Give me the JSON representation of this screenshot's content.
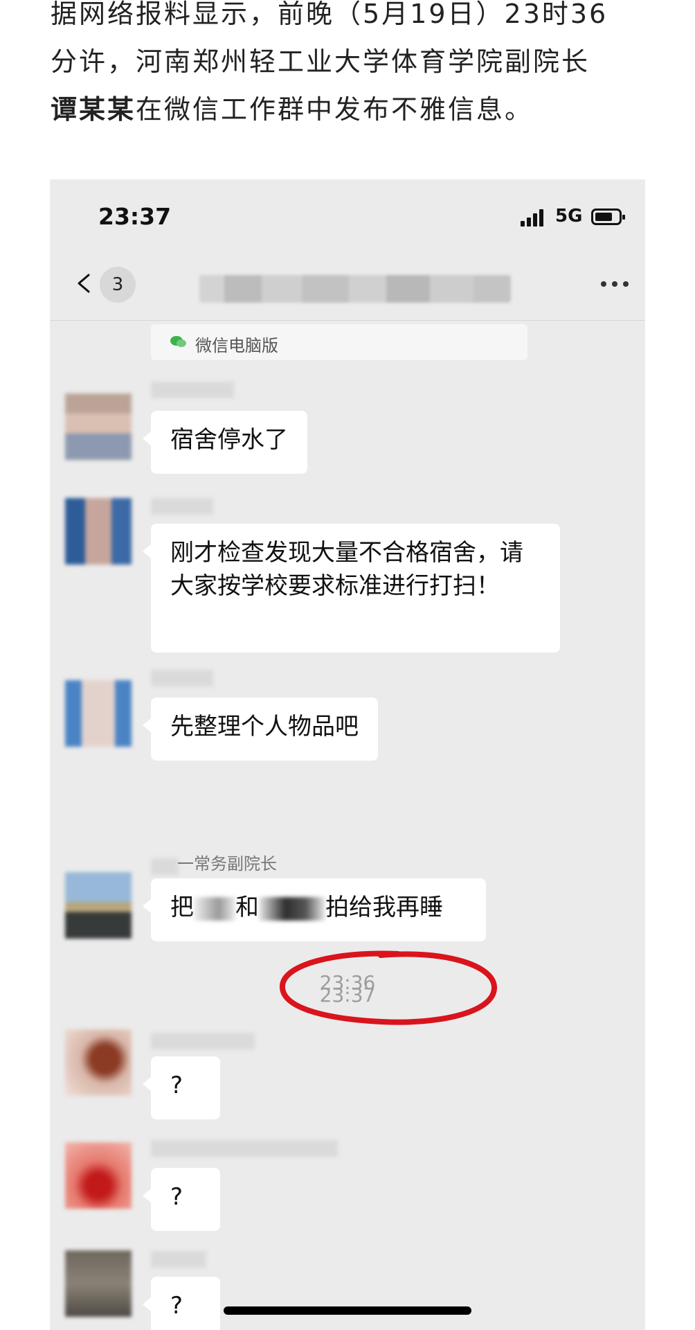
{
  "article": {
    "line1": "据网络报料显示，前晚（5月19日）23时36",
    "line2": "分许，河南郑州轻工业大学体育学院副院长",
    "line3_bold": "谭某某",
    "line3_rest": "在微信工作群中发布不雅信息。"
  },
  "phone": {
    "status": {
      "time": "23:37",
      "network": "5G"
    },
    "nav": {
      "unread_count": "3"
    },
    "client_tag": "微信电脑版",
    "messages": [
      {
        "text": "宿舍停水了"
      },
      {
        "text": "刚才检查发现大量不合格宿舍，请大家按学校要求标准进行打扫！"
      },
      {
        "text": "先整理个人物品吧"
      }
    ],
    "timestamp1": "23:36",
    "vp_message": {
      "sender": "一常务副院长",
      "part1": "把",
      "part2": "和",
      "part3": "拍给我再睡"
    },
    "timestamp2": "23:37",
    "replies": [
      "?",
      "?",
      "?"
    ]
  },
  "colors": {
    "highlight_circle": "#d9141c",
    "chat_bg": "#ebebeb",
    "bubble": "#ffffff"
  }
}
